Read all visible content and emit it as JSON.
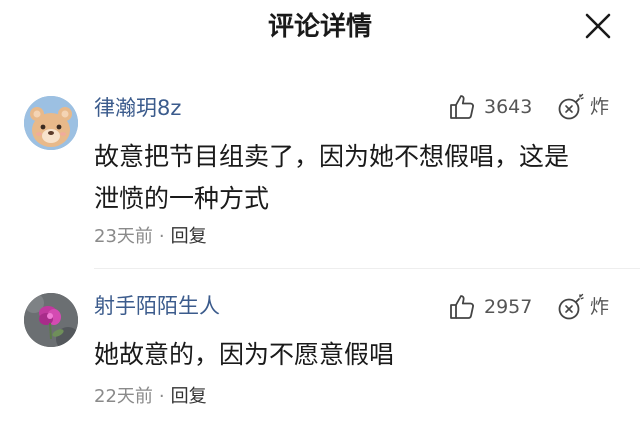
{
  "header": {
    "title": "评论详情",
    "close_icon": "close-icon"
  },
  "comments": [
    {
      "username": "律瀚玥8z",
      "avatar": "cartoon-bear-avatar",
      "likes": "3643",
      "reaction_label": "炸",
      "text_line1": "故意把节目组卖了，因为她不想假唱，这是",
      "text_line2": "泄愤的一种方式",
      "time": "23天前",
      "dot": "·",
      "reply_label": "回复"
    },
    {
      "username": "射手陌陌生人",
      "avatar": "flower-photo-avatar",
      "likes": "2957",
      "reaction_label": "炸",
      "text_line1": "她故意的，因为不愿意假唱",
      "time": "22天前",
      "dot": "·",
      "reply_label": "回复"
    }
  ],
  "colors": {
    "username": "#3b5b8c",
    "meta": "#8a8a8a",
    "text": "#1a1a1a"
  }
}
